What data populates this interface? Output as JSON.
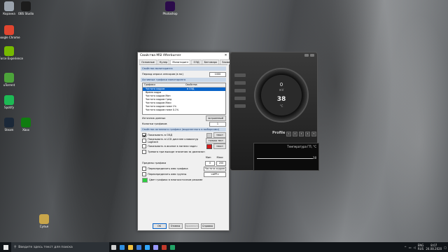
{
  "desktop": {
    "icons": [
      {
        "label": "Корзина",
        "color": "#9aa3ad"
      },
      {
        "label": "OBS Studio",
        "color": "#1c1c1c"
      },
      {
        "label": "Google Chrome",
        "color": "#e0452f"
      },
      {
        "label": "GeForce Experience",
        "color": "#76b900"
      },
      {
        "label": "uTorrent",
        "color": "#4ca33a"
      },
      {
        "label": "Spotify",
        "color": "#1db954"
      },
      {
        "label": "Steam",
        "color": "#1b2838"
      },
      {
        "label": "Xbox",
        "color": "#107c10"
      },
      {
        "label": "Photoshop",
        "color": "#2b0b4a"
      },
      {
        "label": "Сулье",
        "color": "#c9a64a"
      }
    ]
  },
  "dialog": {
    "title": "Свойства MSI Afterburner",
    "close": "✕",
    "tabs": [
      "Основные",
      "Кулер",
      "Мониторинг",
      "ОЭД",
      "Бенчмарк",
      "Захват скрины"
    ],
    "active_tab": 2,
    "section1": "Свойства мониторинга",
    "poll_label": "Период опроса сенсоров (в мс)",
    "poll_value": "1000",
    "active_graphs_section": "Активные графики мониторинга",
    "list_headers": [
      "Графики",
      "Свойства"
    ],
    "list_items": [
      {
        "name": "Частота кадров",
        "prop": "в ОЭД",
        "selected": true
      },
      {
        "name": "Время кадра",
        "prop": "",
        "selected": false
      },
      {
        "name": "Частота кадров Мин",
        "prop": "",
        "selected": false
      },
      {
        "name": "Частота кадров Сред",
        "prop": "",
        "selected": false
      },
      {
        "name": "Частота кадров Макс",
        "prop": "",
        "selected": false
      },
      {
        "name": "Частота кадров ниже 1%",
        "prop": "",
        "selected": false
      },
      {
        "name": "Частота кадров ниже 0.1%",
        "prop": "",
        "selected": false
      }
    ],
    "data_source_label": "Источник данных",
    "data_source_button": "встроенный",
    "count_label": "Колонки графиков",
    "count_value": "1",
    "section2": "Свойства активного графика (выделенного в выборками)",
    "show_osd_label": "Показывать в ОЭД",
    "show_osd_value": "текст",
    "lcd_label": "Показывать в LCD дисплее клавиатур Logitech",
    "lcd_value": "только тест",
    "tray_label": "Показывать в иконке в панели задач",
    "tray_value": "текст",
    "alarm_label": "Тревога при выходе значения за диапазон",
    "min_label": "Мин",
    "max_label": "Макс",
    "limits_label": "Пределы графика",
    "limit_min": "0",
    "limit_max": "200",
    "override_name_label": "Переопределить имя графика",
    "override_name_value": "Частота кадров",
    "override_group_label": "Переопределить имя группы",
    "override_group_value": "<APP>",
    "multisource_label": "Цвет графика в многоисточном режиме",
    "ok": "OK",
    "cancel": "Отмена",
    "apply": "Применить",
    "help": "Справка"
  },
  "afterburner": {
    "gauge_value": "0",
    "gauge_unit": "mV",
    "temp_value": "38",
    "temp_unit": "°C",
    "profile": "Profile",
    "slots": [
      "1",
      "2",
      "3",
      "4",
      "5"
    ],
    "monitor_label": "Температура ГП, °C",
    "monitor_value": "38"
  },
  "taskbar": {
    "search_placeholder": "Введите здесь текст для поиска",
    "apps": [
      {
        "name": "task-view",
        "color": "#cfcfcf"
      },
      {
        "name": "edge",
        "color": "#2f8ee0"
      },
      {
        "name": "explorer",
        "color": "#f0c040"
      },
      {
        "name": "store",
        "color": "#3a7bd5"
      },
      {
        "name": "photoshop",
        "color": "#31a8ff"
      },
      {
        "name": "premiere",
        "color": "#9999ff"
      },
      {
        "name": "afterburner",
        "color": "#c0392b"
      },
      {
        "name": "excel",
        "color": "#21a366"
      }
    ],
    "lang": "ENG",
    "lang2": "RUS",
    "time": "8:07",
    "date": "24.08.2020"
  }
}
